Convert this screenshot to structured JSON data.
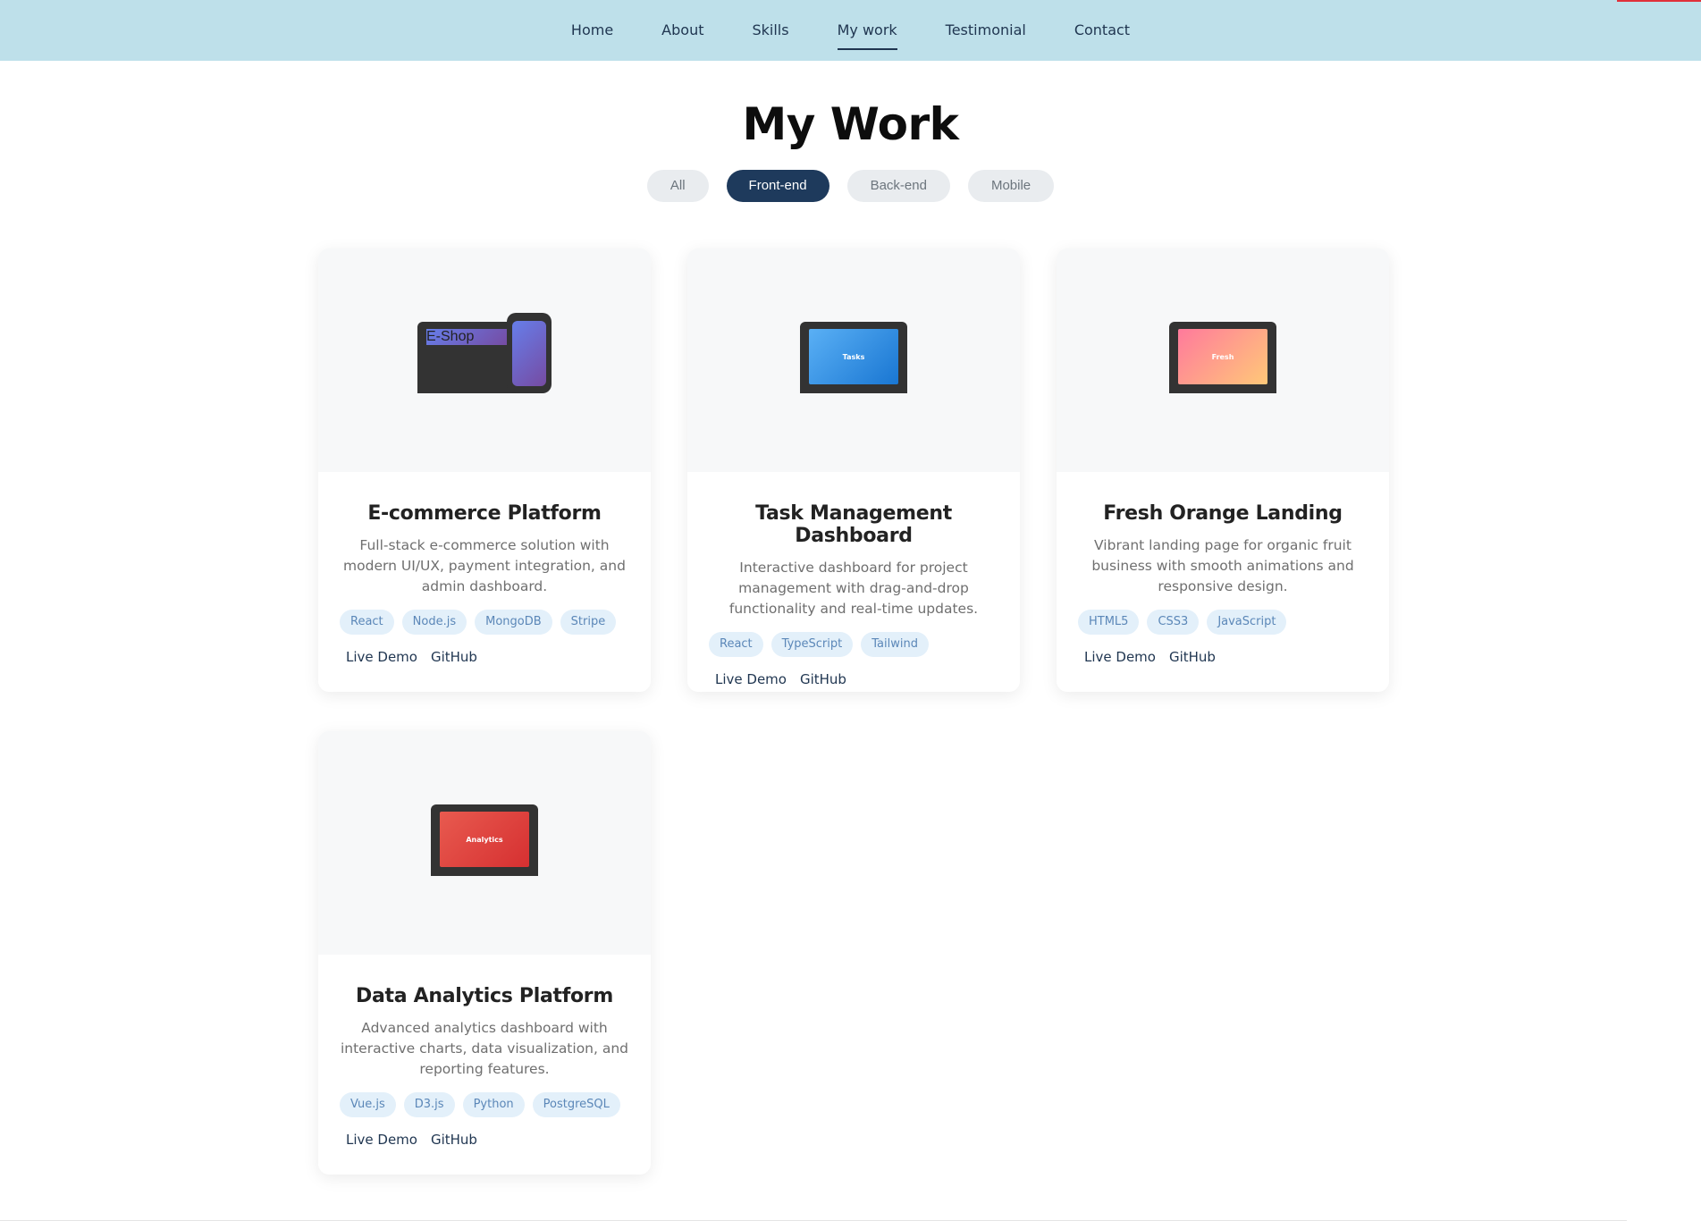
{
  "nav": {
    "items": [
      {
        "label": "Home"
      },
      {
        "label": "About"
      },
      {
        "label": "Skills"
      },
      {
        "label": "My work",
        "active": true
      },
      {
        "label": "Testimonial"
      },
      {
        "label": "Contact"
      }
    ]
  },
  "section": {
    "title": "My Work"
  },
  "filters": [
    {
      "label": "All"
    },
    {
      "label": "Front-end",
      "active": true
    },
    {
      "label": "Back-end"
    },
    {
      "label": "Mobile"
    }
  ],
  "projects": [
    {
      "title": "E-commerce Platform",
      "description": "Full-stack e-commerce solution with modern UI/UX, payment integration, and admin dashboard.",
      "mockup_label": "E-Shop",
      "mockup_colors": [
        "#667eea",
        "#764ba2"
      ],
      "tags": [
        "React",
        "Node.js",
        "MongoDB",
        "Stripe"
      ],
      "links": [
        "Live Demo",
        "GitHub"
      ]
    },
    {
      "title": "Task Management Dashboard",
      "description": "Interactive dashboard for project management with drag-and-drop functionality and real-time updates.",
      "mockup_label": "Tasks",
      "mockup_colors": [
        "#5ab0f5",
        "#1976d2"
      ],
      "tags": [
        "React",
        "TypeScript",
        "Tailwind"
      ],
      "links": [
        "Live Demo",
        "GitHub"
      ]
    },
    {
      "title": "Fresh Orange Landing",
      "description": "Vibrant landing page for organic fruit business with smooth animations and responsive design.",
      "mockup_label": "Fresh",
      "mockup_colors": [
        "#ff7a9c",
        "#ffc878"
      ],
      "tags": [
        "HTML5",
        "CSS3",
        "JavaScript"
      ],
      "links": [
        "Live Demo",
        "GitHub"
      ]
    },
    {
      "title": "Data Analytics Platform",
      "description": "Advanced analytics dashboard with interactive charts, data visualization, and reporting features.",
      "mockup_label": "Analytics",
      "mockup_colors": [
        "#e85a4f",
        "#d63031"
      ],
      "tags": [
        "Vue.js",
        "D3.js",
        "Python",
        "PostgreSQL"
      ],
      "links": [
        "Live Demo",
        "GitHub"
      ]
    }
  ]
}
